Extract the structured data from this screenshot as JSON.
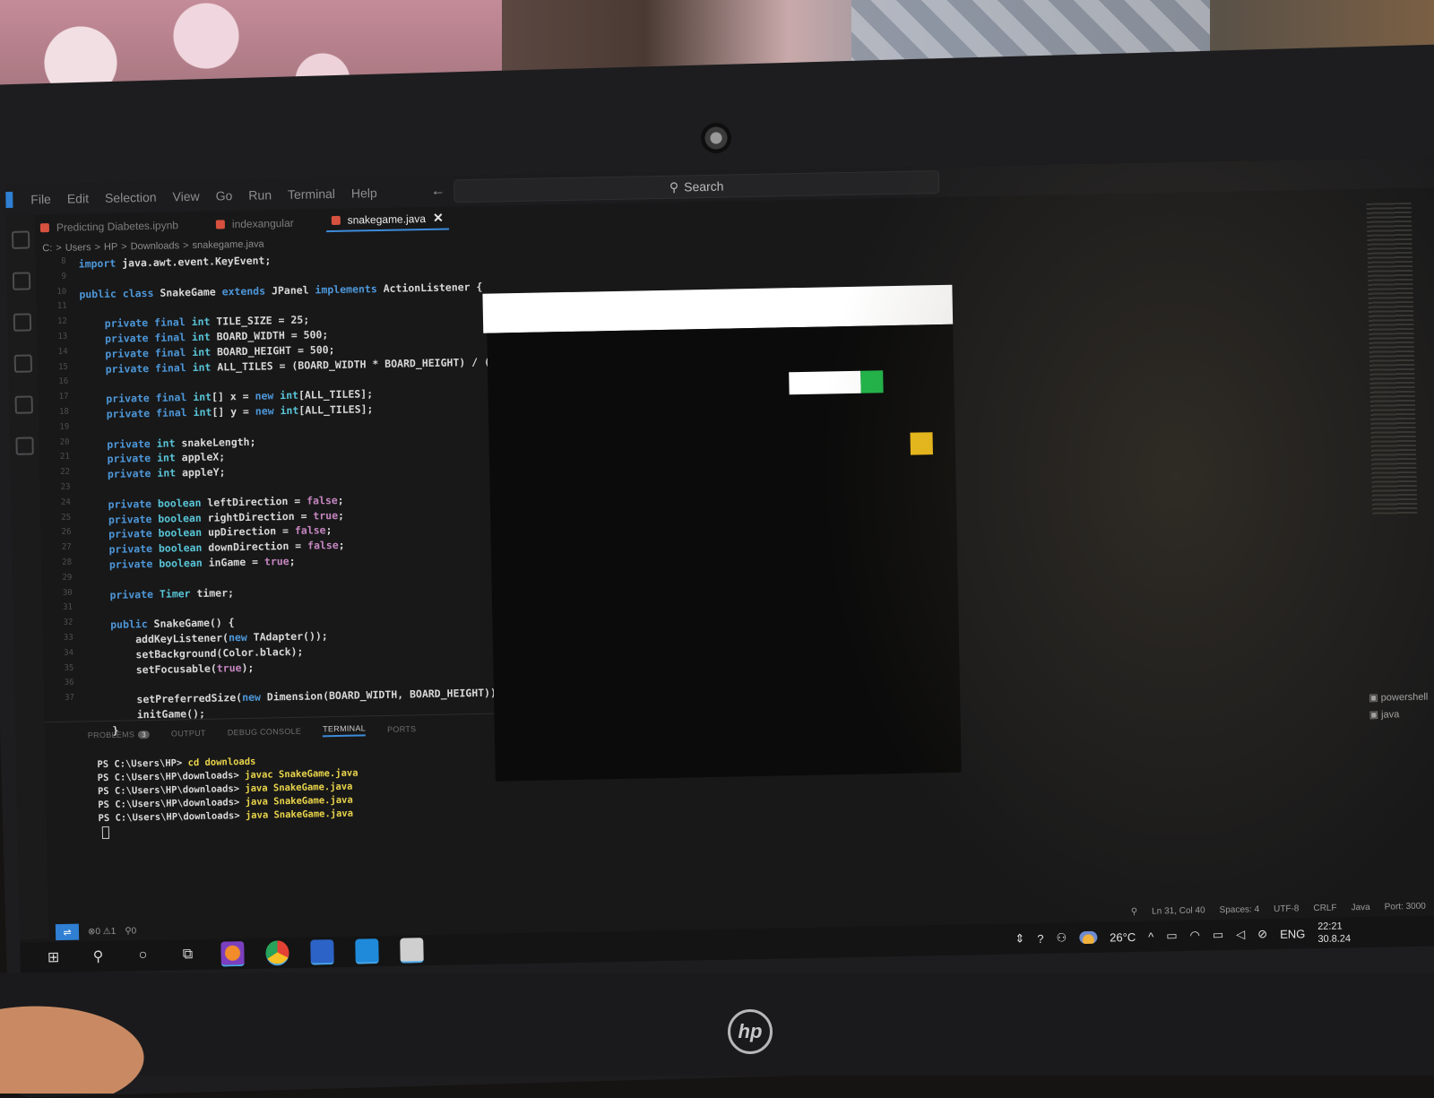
{
  "menu": [
    "File",
    "Edit",
    "Selection",
    "View",
    "Go",
    "Run",
    "Terminal",
    "Help"
  ],
  "search_label": "Search",
  "tabs": [
    {
      "label": "Predicting Diabetes.ipynb"
    },
    {
      "label": "indexangular"
    },
    {
      "label": "snakegame.java"
    }
  ],
  "breadcrumb": [
    "C:",
    ">",
    "Users",
    ">",
    "HP",
    ">",
    "Downloads",
    ">",
    "snakegame.java"
  ],
  "editor": {
    "line_numbers": [
      "8",
      "9",
      "10",
      "11",
      "12",
      "13",
      "14",
      "15",
      "16",
      "17",
      "18",
      "19",
      "20",
      "21",
      "22",
      "23",
      "24",
      "25",
      "26",
      "27",
      "28",
      "29",
      "30",
      "31",
      "32",
      "33",
      "34",
      "35",
      "36",
      "37"
    ],
    "lines": [
      "import java.awt.event.KeyEvent;",
      "",
      "public class SnakeGame extends JPanel implements ActionListener {",
      "",
      "    private final int TILE_SIZE = 25;",
      "    private final int BOARD_WIDTH = 500;",
      "    private final int BOARD_HEIGHT = 500;",
      "    private final int ALL_TILES = (BOARD_WIDTH * BOARD_HEIGHT) / (",
      "",
      "    private final int[] x = new int[ALL_TILES];",
      "    private final int[] y = new int[ALL_TILES];",
      "",
      "    private int snakeLength;",
      "    private int appleX;",
      "    private int appleY;",
      "",
      "    private boolean leftDirection = false;",
      "    private boolean rightDirection = true;",
      "    private boolean upDirection = false;",
      "    private boolean downDirection = false;",
      "    private boolean inGame = true;",
      "",
      "    private Timer timer;",
      "",
      "    public SnakeGame() {",
      "        addKeyListener(new TAdapter());",
      "        setBackground(Color.black);",
      "        setFocusable(true);",
      "",
      "        setPreferredSize(new Dimension(BOARD_WIDTH, BOARD_HEIGHT));",
      "        initGame();",
      "    }"
    ]
  },
  "panel": {
    "tabs": [
      "PROBLEMS",
      "OUTPUT",
      "DEBUG CONSOLE",
      "TERMINAL",
      "PORTS"
    ],
    "problems_count": "3",
    "terminal": [
      {
        "prompt": "PS C:\\Users\\HP>",
        "cmd": " cd downloads"
      },
      {
        "prompt": "PS C:\\Users\\HP\\downloads>",
        "cmd": " javac SnakeGame.java"
      },
      {
        "prompt": "PS C:\\Users\\HP\\downloads>",
        "cmd": " java SnakeGame.java"
      },
      {
        "prompt": "PS C:\\Users\\HP\\downloads>",
        "cmd": " java SnakeGame.java"
      },
      {
        "prompt": "PS C:\\Users\\HP\\downloads>",
        "cmd": " java SnakeGame.java"
      }
    ]
  },
  "side_panel": [
    "powershell",
    "java"
  ],
  "statusbar": {
    "errors": "⊗0 ⚠1",
    "ports": "⚲0",
    "position": "Ln 31, Col 40",
    "spaces": "Spaces: 4",
    "encoding": "UTF-8",
    "eol": "CRLF",
    "language": "Java",
    "port": "Port: 3000"
  },
  "taskbar": {
    "temperature": "26°C",
    "language": "ENG",
    "time": "22:21",
    "date": "30.8.24"
  },
  "colors": {
    "snake_head": "#21b54a",
    "snake_body": "#ffffff",
    "apple": "#f2c01a",
    "accent": "#2f7fd3"
  }
}
